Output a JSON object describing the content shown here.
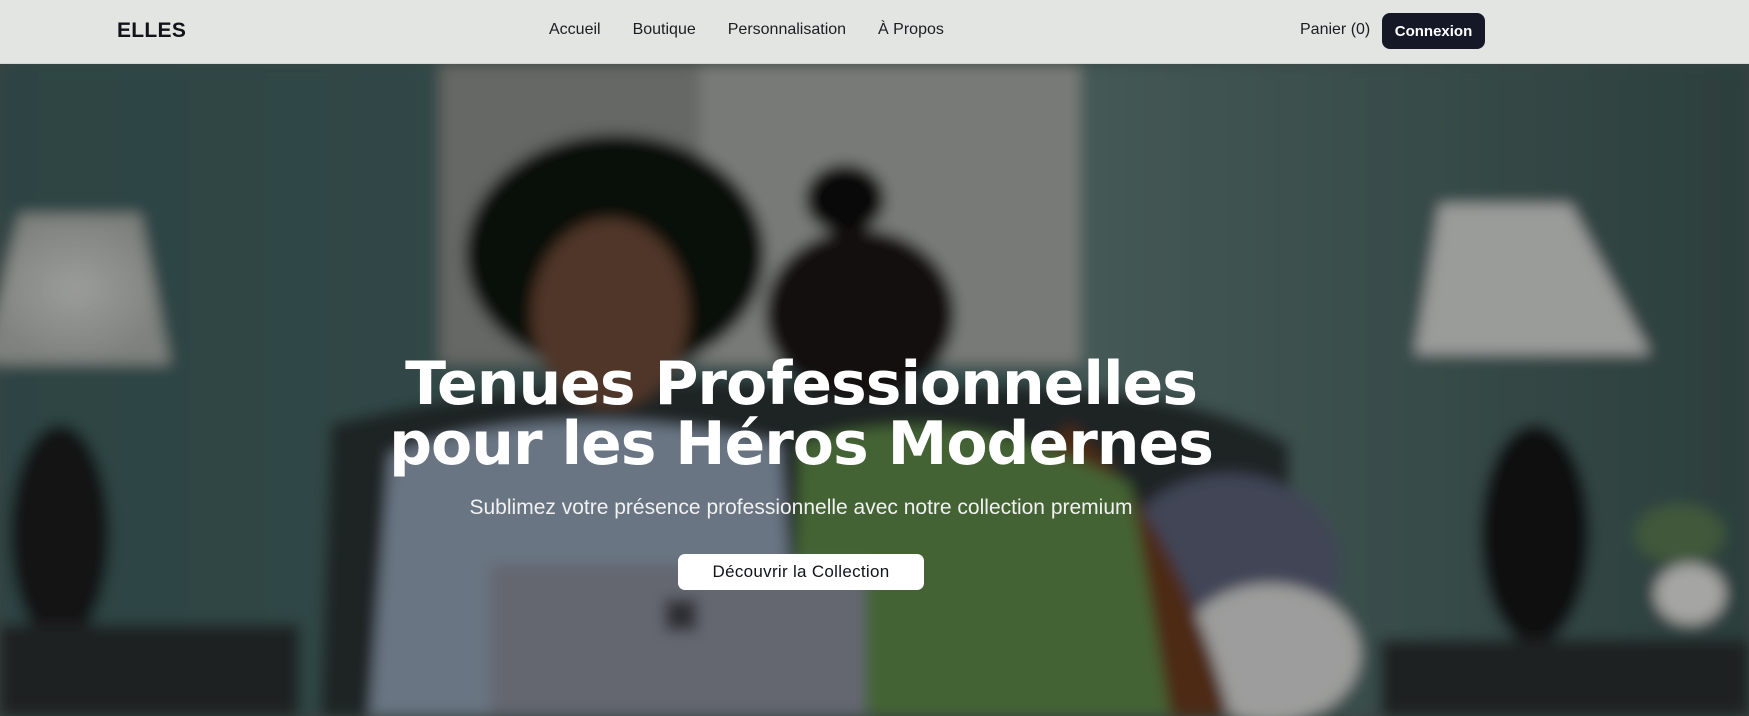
{
  "brand": {
    "logo": "ELLES"
  },
  "nav": {
    "links": [
      {
        "label": "Accueil"
      },
      {
        "label": "Boutique"
      },
      {
        "label": "Personnalisation"
      },
      {
        "label": "À Propos"
      }
    ],
    "cart_label": "Panier (0)",
    "login_label": "Connexion"
  },
  "hero": {
    "title_line1": "Tenues Professionnelles",
    "title_line2": "pour les Héros Modernes",
    "subtitle": "Sublimez votre présence professionnelle avec notre collection premium",
    "cta_label": "Découvrir la Collection"
  },
  "colors": {
    "navbar_bg": "#e3e5e3",
    "button_dark": "#151827",
    "cta_bg": "#ffffff",
    "hero_text": "#ffffff"
  }
}
